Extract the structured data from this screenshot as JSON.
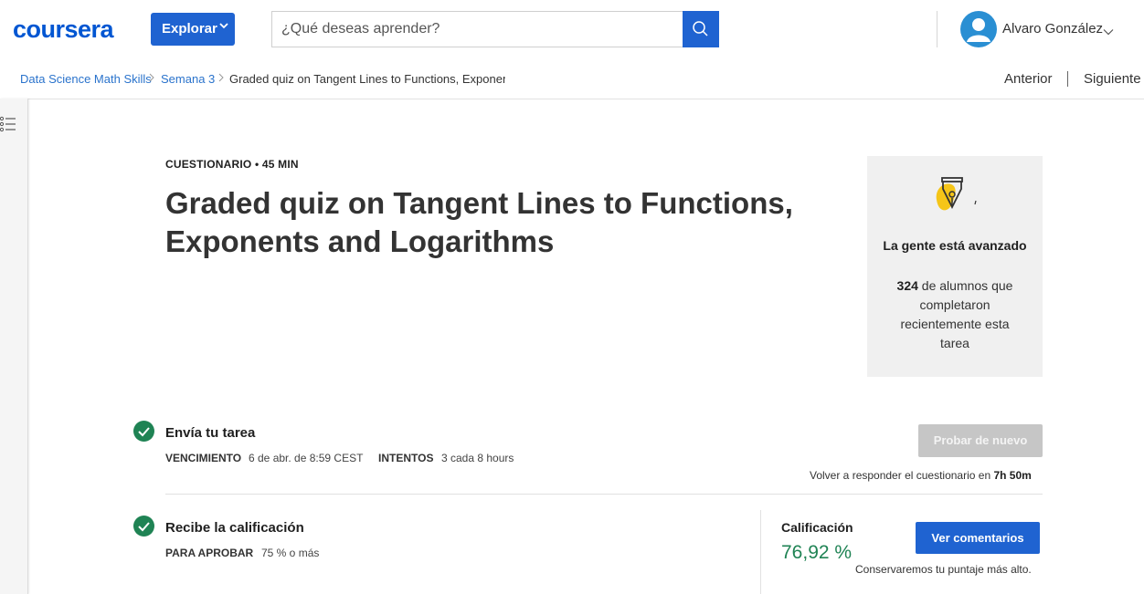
{
  "header": {
    "logo_text": "coursera",
    "explore_label": "Explorar",
    "search_placeholder": "¿Qué deseas aprender?",
    "user_name": "Alvaro González",
    "brand_color": "#0056d2",
    "accent_color": "#1f63d1"
  },
  "breadcrumb": {
    "items": [
      "Data Science Math Skills",
      "Semana 3",
      "Graded quiz on Tangent Lines to Functions, Exponents and Logarithms"
    ],
    "prev_label": "Anterior",
    "next_label": "Siguiente"
  },
  "quiz": {
    "kicker": "CUESTIONARIO • 45 MIN",
    "title": "Graded quiz on Tangent Lines to Functions, Exponents and Logarithms"
  },
  "social_card": {
    "heading": "La gente está avanzado",
    "count": "324",
    "body": "de alumnos que completaron recientemente esta tarea"
  },
  "submit_step": {
    "title": "Envía tu tarea",
    "due_label": "VENCIMIENTO",
    "due_value": "6 de abr. de 8:59 CEST",
    "attempts_label": "INTENTOS",
    "attempts_value": "3 cada 8 hours",
    "retry_label": "Probar de nuevo",
    "retry_note_prefix": "Volver a responder el cuestionario en",
    "retry_note_time": "7h 50m"
  },
  "grade_step": {
    "title": "Recibe la calificación",
    "pass_label": "PARA APROBAR",
    "pass_value": "75 % o más",
    "grade_label": "Calificación",
    "grade_value": "76,92 %",
    "feedback_label": "Ver comentarios",
    "keep_note": "Conservaremos tu puntaje más alto.",
    "success_color": "#1f8354"
  }
}
